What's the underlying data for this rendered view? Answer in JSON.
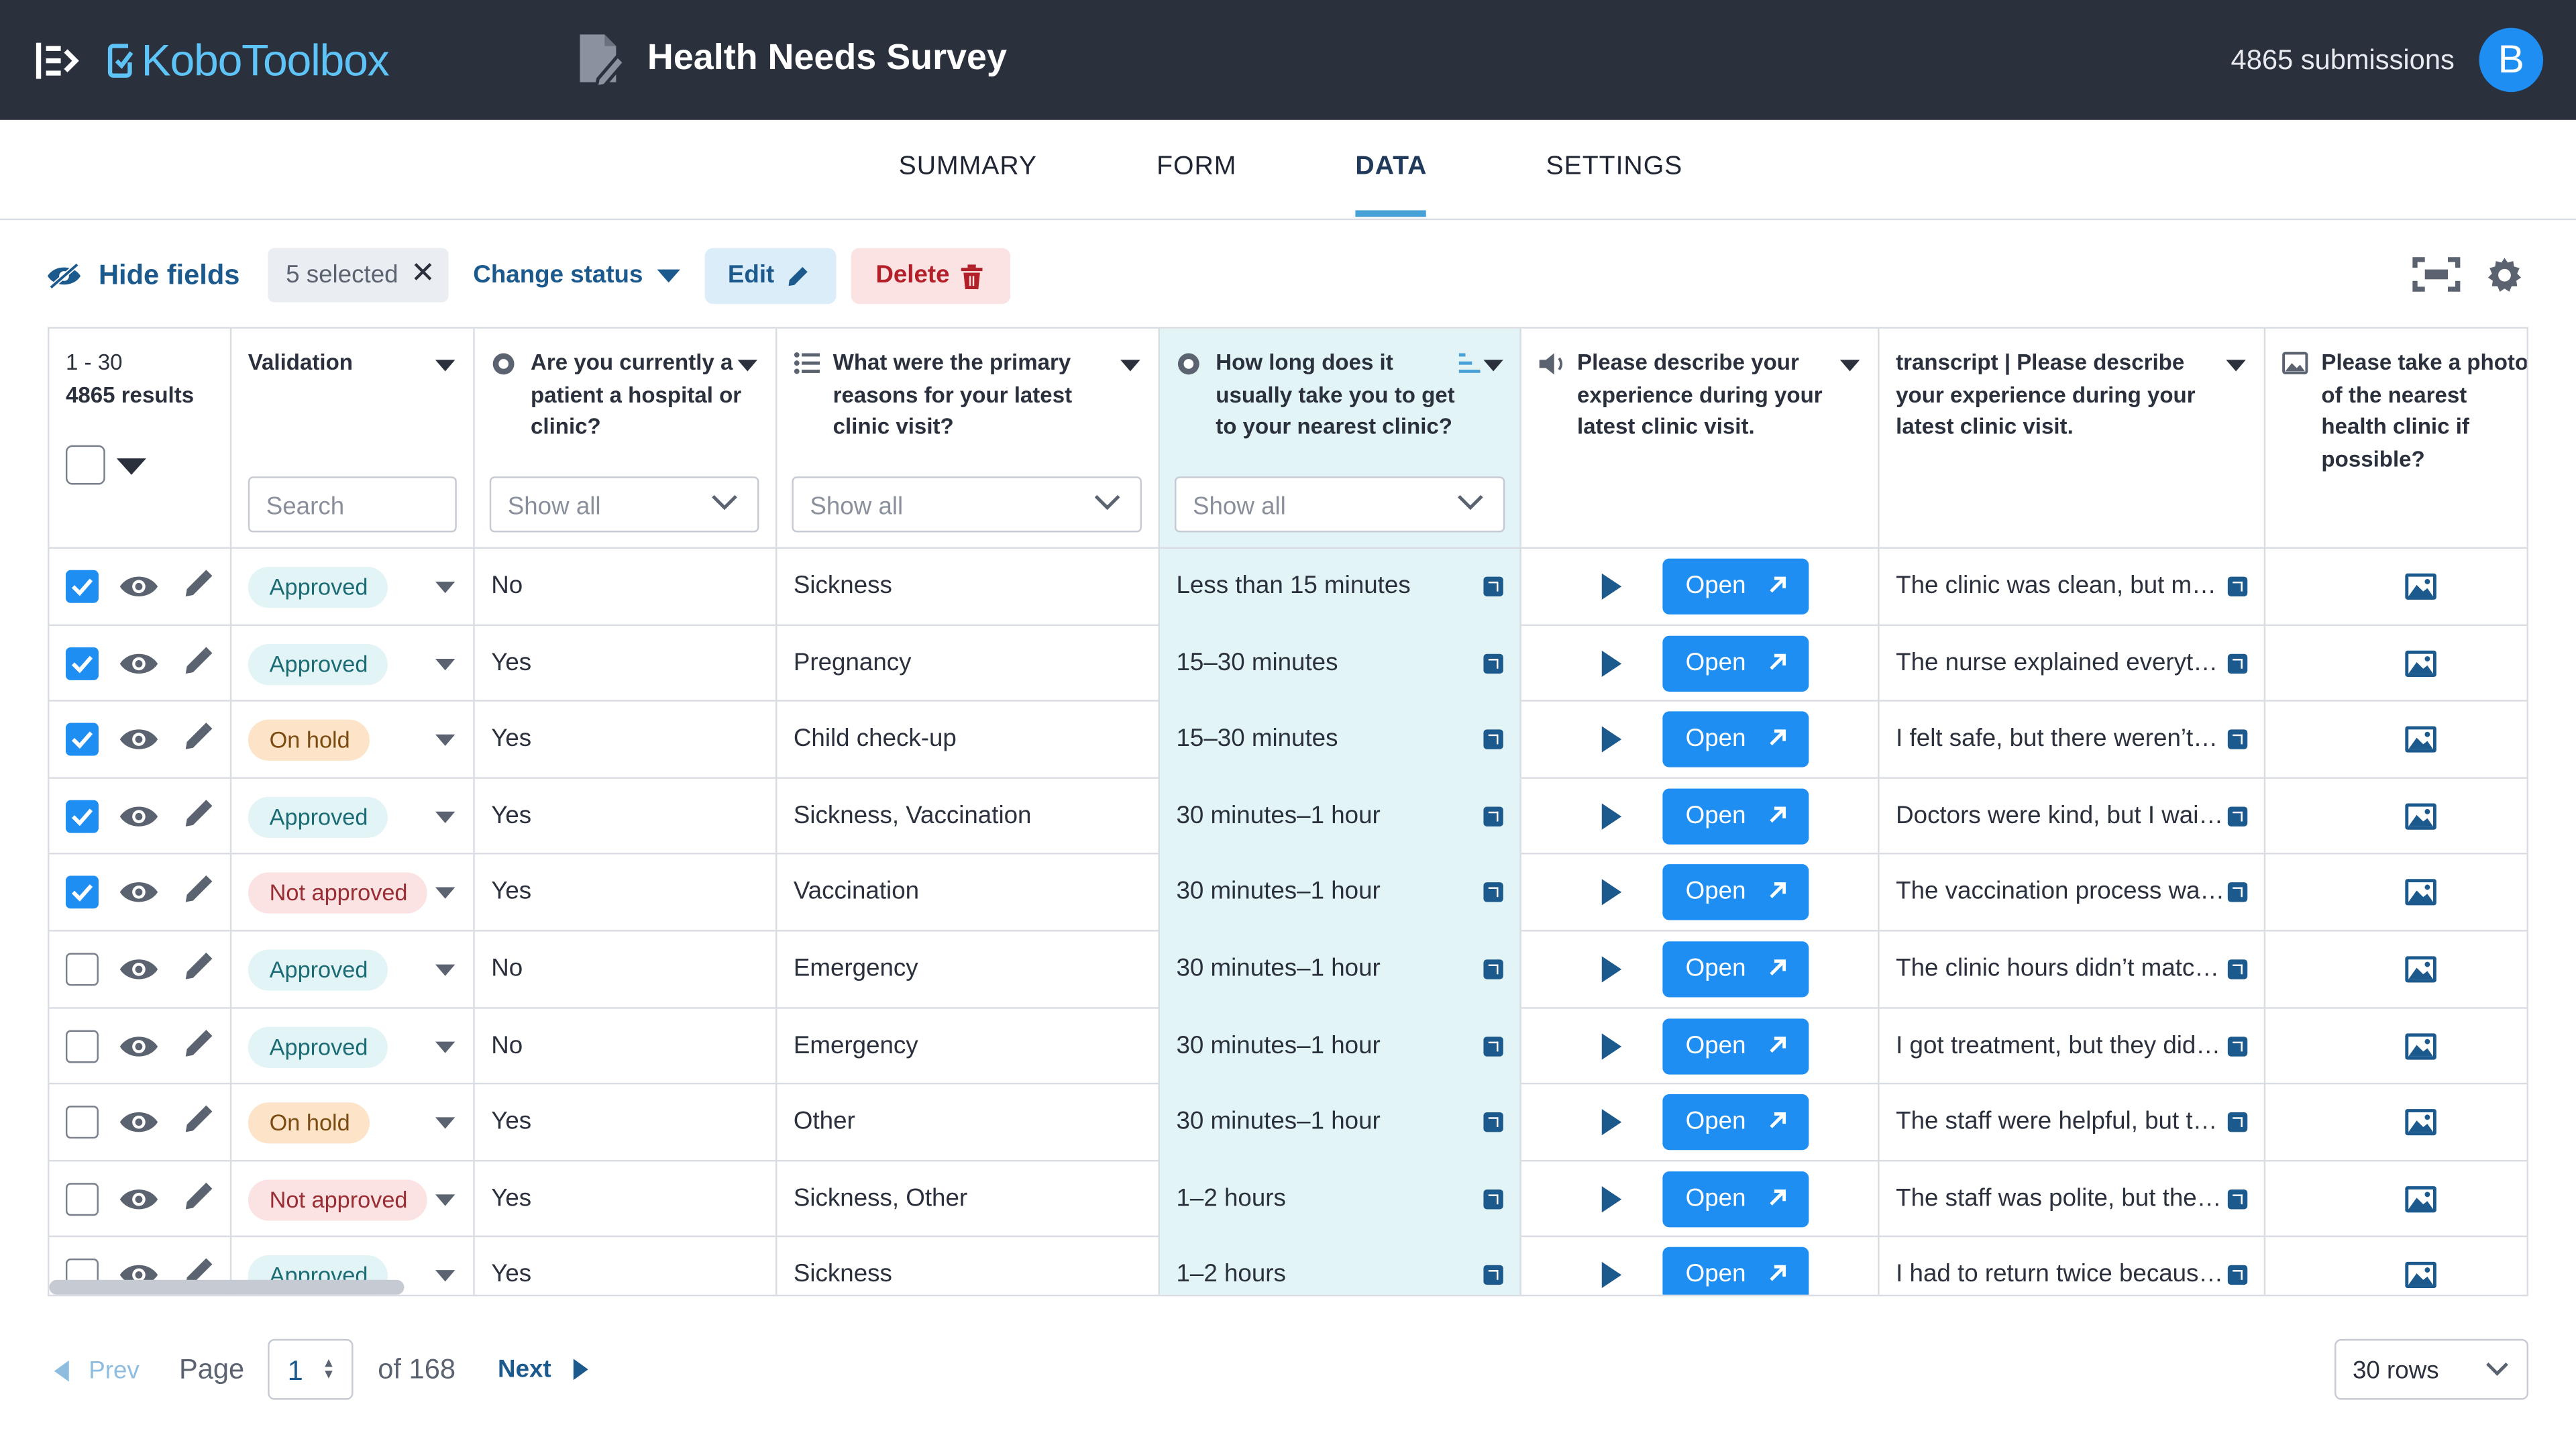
{
  "app": {
    "logo_text": "KoboToolbox",
    "avatar_letter": "B"
  },
  "header": {
    "survey_title": "Health Needs Survey",
    "submissions": "4865 submissions"
  },
  "tabs": [
    {
      "label": "SUMMARY",
      "active": false
    },
    {
      "label": "FORM",
      "active": false
    },
    {
      "label": "DATA",
      "active": true
    },
    {
      "label": "SETTINGS",
      "active": false
    }
  ],
  "toolbar": {
    "hide_fields": "Hide fields",
    "selected": "5 selected",
    "change_status": "Change status",
    "edit": "Edit",
    "delete": "Delete"
  },
  "table": {
    "range": "1 - 30",
    "results": "4865 results",
    "columns": [
      {
        "title": "Validation",
        "filter_placeholder": "Search"
      },
      {
        "title": "Are you currently a patient a hospital or clinic?",
        "filter": "Show all"
      },
      {
        "title": "What were the primary reasons for your latest clinic visit?",
        "filter": "Show all"
      },
      {
        "title": "How long does it usually take you to get to your nearest clinic?",
        "filter": "Show all"
      },
      {
        "title": "Please describe your experience during your latest clinic visit."
      },
      {
        "title": "transcript | Please describe your experience during your latest clinic visit."
      },
      {
        "title": "Please take a photo of the nearest health clinic if possible?"
      }
    ],
    "open_label": "Open",
    "rows": [
      {
        "checked": true,
        "status": "Approved",
        "patient": "No",
        "reason": "Sickness",
        "duration": "Less than 15 minutes",
        "transcript": "The clinic was clean, but m…"
      },
      {
        "checked": true,
        "status": "Approved",
        "patient": "Yes",
        "reason": "Pregnancy",
        "duration": "15–30 minutes",
        "transcript": "The nurse explained everyt…"
      },
      {
        "checked": true,
        "status": "On hold",
        "patient": "Yes",
        "reason": "Child check-up",
        "duration": "15–30 minutes",
        "transcript": "I felt safe, but there weren’t…"
      },
      {
        "checked": true,
        "status": "Approved",
        "patient": "Yes",
        "reason": "Sickness, Vaccination",
        "duration": "30 minutes–1 hour",
        "transcript": "Doctors were kind, but I wai…"
      },
      {
        "checked": true,
        "status": "Not approved",
        "patient": "Yes",
        "reason": "Vaccination",
        "duration": "30 minutes–1 hour",
        "transcript": "The vaccination process wa…"
      },
      {
        "checked": false,
        "status": "Approved",
        "patient": "No",
        "reason": "Emergency",
        "duration": "30 minutes–1 hour",
        "transcript": "The clinic hours didn’t matc…"
      },
      {
        "checked": false,
        "status": "Approved",
        "patient": "No",
        "reason": "Emergency",
        "duration": "30 minutes–1 hour",
        "transcript": "I got treatment, but they did…"
      },
      {
        "checked": false,
        "status": "On hold",
        "patient": "Yes",
        "reason": "Other",
        "duration": "30 minutes–1 hour",
        "transcript": "The staff were helpful, but t…"
      },
      {
        "checked": false,
        "status": "Not approved",
        "patient": "Yes",
        "reason": "Sickness, Other",
        "duration": "1–2 hours",
        "transcript": "The staff was polite, but the…"
      },
      {
        "checked": false,
        "status": "Approved",
        "patient": "Yes",
        "reason": "Sickness",
        "duration": "1–2 hours",
        "transcript": "I had to return twice becaus…"
      }
    ]
  },
  "pager": {
    "prev": "Prev",
    "page_label": "Page",
    "page": "1",
    "of": "of 168",
    "next": "Next",
    "rows_per_page": "30 rows"
  },
  "colors": {
    "topbar": "#2b303d",
    "accent": "#1e8ef2",
    "link": "#1c5a8e",
    "highlight_column": "#e3f4f6"
  }
}
